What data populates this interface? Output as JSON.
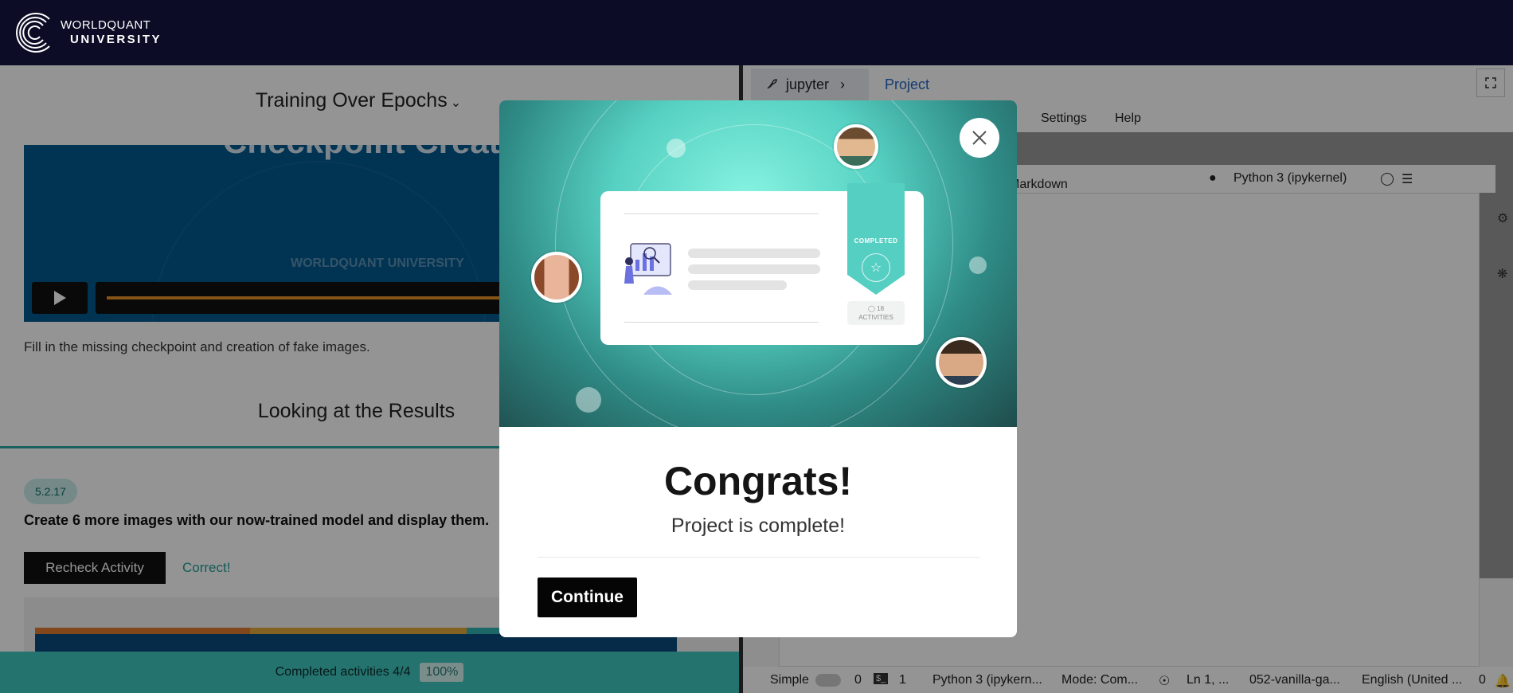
{
  "brand": {
    "line1": "WORLDQUANT",
    "line2": "UNIVERSITY"
  },
  "lesson": {
    "title": "Training Over Epochs",
    "video_heading": "Checkpoint Creation",
    "video_watermark": "WORLDQUANT UNIVERSITY",
    "description": "Fill in the missing checkpoint and creation of fake images.",
    "section_title": "Looking at the Results",
    "activity_badge": "5.2.17",
    "activity_text": "Create 6 more images with our now-trained model and display them.",
    "recheck_label": "Recheck Activity",
    "result_label": "Correct!",
    "completed_label": "Completed activities 4/4",
    "completed_pct": "100%",
    "completed_fraction": 1.0
  },
  "jupyter": {
    "tab_label": "jupyter",
    "breadcrumb": "Project",
    "menu": [
      "Settings",
      "Help"
    ],
    "menu_partial": "s",
    "cell_type": "Markdown",
    "kernel": "Python 3 (ipykernel)",
    "status": {
      "mode_label": "Simple",
      "count_a": "0",
      "count_b": "1",
      "kernel_short": "Python 3 (ipykern...",
      "mode": "Mode: Com...",
      "position": "Ln 1, ...",
      "file": "052-vanilla-ga...",
      "language": "English (United ...",
      "notifications": "0"
    }
  },
  "modal": {
    "headline": "Congrats!",
    "subtext": "Project is complete!",
    "continue_label": "Continue",
    "ribbon_label": "COMPLETED",
    "activities_count": "18",
    "activities_label": "ACTIVITIES"
  },
  "colors": {
    "topbar": "#0c0c26",
    "accent": "#3fc6bd",
    "link": "#1f66c4",
    "success": "#1e9e97"
  }
}
